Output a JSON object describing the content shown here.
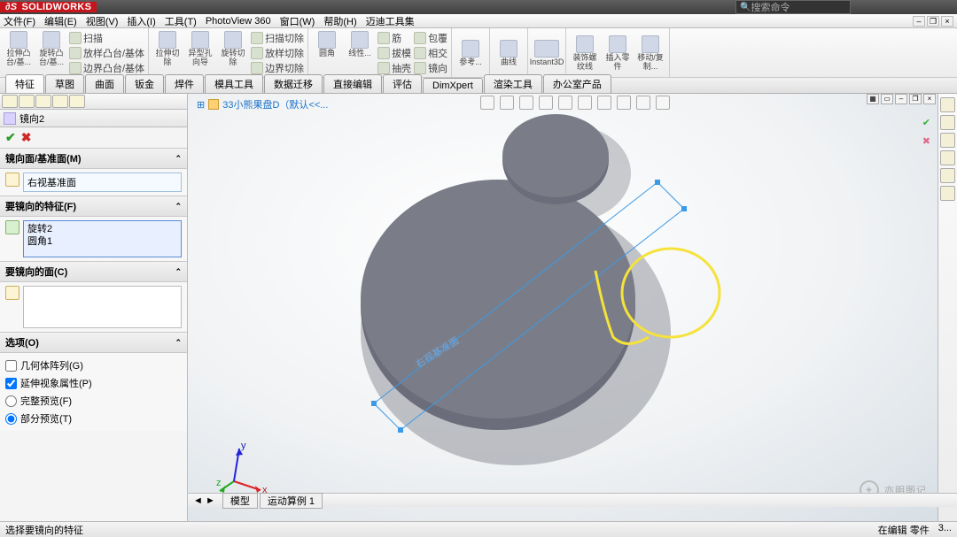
{
  "app": {
    "brand": "SOLIDWORKS",
    "search_placeholder": "搜索命令"
  },
  "menu": [
    "文件(F)",
    "编辑(E)",
    "视图(V)",
    "插入(I)",
    "工具(T)",
    "PhotoView 360",
    "窗口(W)",
    "帮助(H)",
    "迈迪工具集"
  ],
  "ribbon": {
    "g1": {
      "btns": [
        "拉伸凸台/基...",
        "旋转凸台/基..."
      ],
      "rows": [
        "扫描",
        "放样凸台/基体",
        "边界凸台/基体"
      ]
    },
    "g2": {
      "btns": [
        "拉伸切除",
        "异型孔向导",
        "旋转切除"
      ],
      "rows": [
        "扫描切除",
        "放样切除",
        "边界切除"
      ]
    },
    "g3": {
      "btns": [
        "圆角",
        "线性..."
      ],
      "rows": [
        "筋",
        "拔模",
        "抽壳",
        "包覆",
        "相交",
        "镜向"
      ]
    },
    "g4": {
      "btns": [
        "参考..."
      ]
    },
    "g5": {
      "btns": [
        "曲线"
      ]
    },
    "g6": {
      "btns": [
        "Instant3D"
      ]
    },
    "g7": {
      "btns": [
        "装饰螺纹线",
        "插入零件",
        "移动/复制..."
      ]
    }
  },
  "tabs": [
    "特征",
    "草图",
    "曲面",
    "钣金",
    "焊件",
    "模具工具",
    "数据迁移",
    "直接编辑",
    "评估",
    "DimXpert",
    "渲染工具",
    "办公室产品"
  ],
  "active_tab": 0,
  "pm": {
    "title": "镜向2",
    "sections": {
      "plane": {
        "title": "镜向面/基准面(M)",
        "value": "右视基准面"
      },
      "features": {
        "title": "要镜向的特征(F)",
        "items": [
          "旋转2",
          "圆角1"
        ]
      },
      "faces": {
        "title": "要镜向的面(C)"
      },
      "options": {
        "title": "选项(O)",
        "geom_pattern": "几何体阵列(G)",
        "extend_visual": "延伸视象属性(P)",
        "full_preview": "完整预览(F)",
        "partial_preview": "部分预览(T)"
      }
    }
  },
  "doc": {
    "name": "33小熊果盘D（默认<<...",
    "plane_label": "右视基准面"
  },
  "bottom_tabs": [
    "模型",
    "运动算例 1"
  ],
  "status": {
    "left": "选择要镜向的特征",
    "mid": "在编辑 零件",
    "right": "3..."
  },
  "watermark": "亦明图记"
}
